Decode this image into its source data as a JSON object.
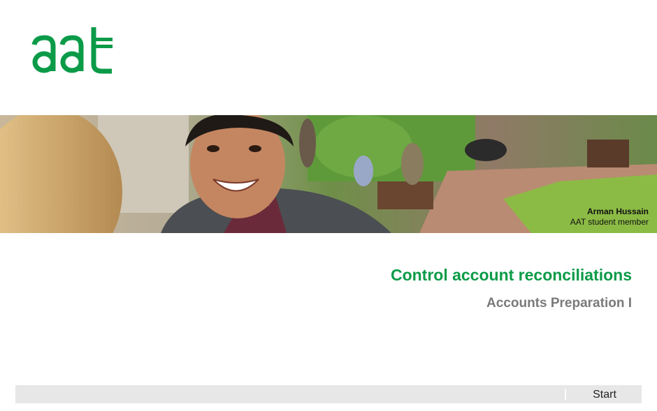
{
  "brand": {
    "logo_text": "aat",
    "accent_color": "#0b9b48"
  },
  "hero": {
    "caption_name": "Arman Hussain",
    "caption_role": "AAT student member"
  },
  "main": {
    "title": "Control account reconciliations",
    "subtitle": "Accounts Preparation I"
  },
  "footer": {
    "start_label": "Start"
  }
}
